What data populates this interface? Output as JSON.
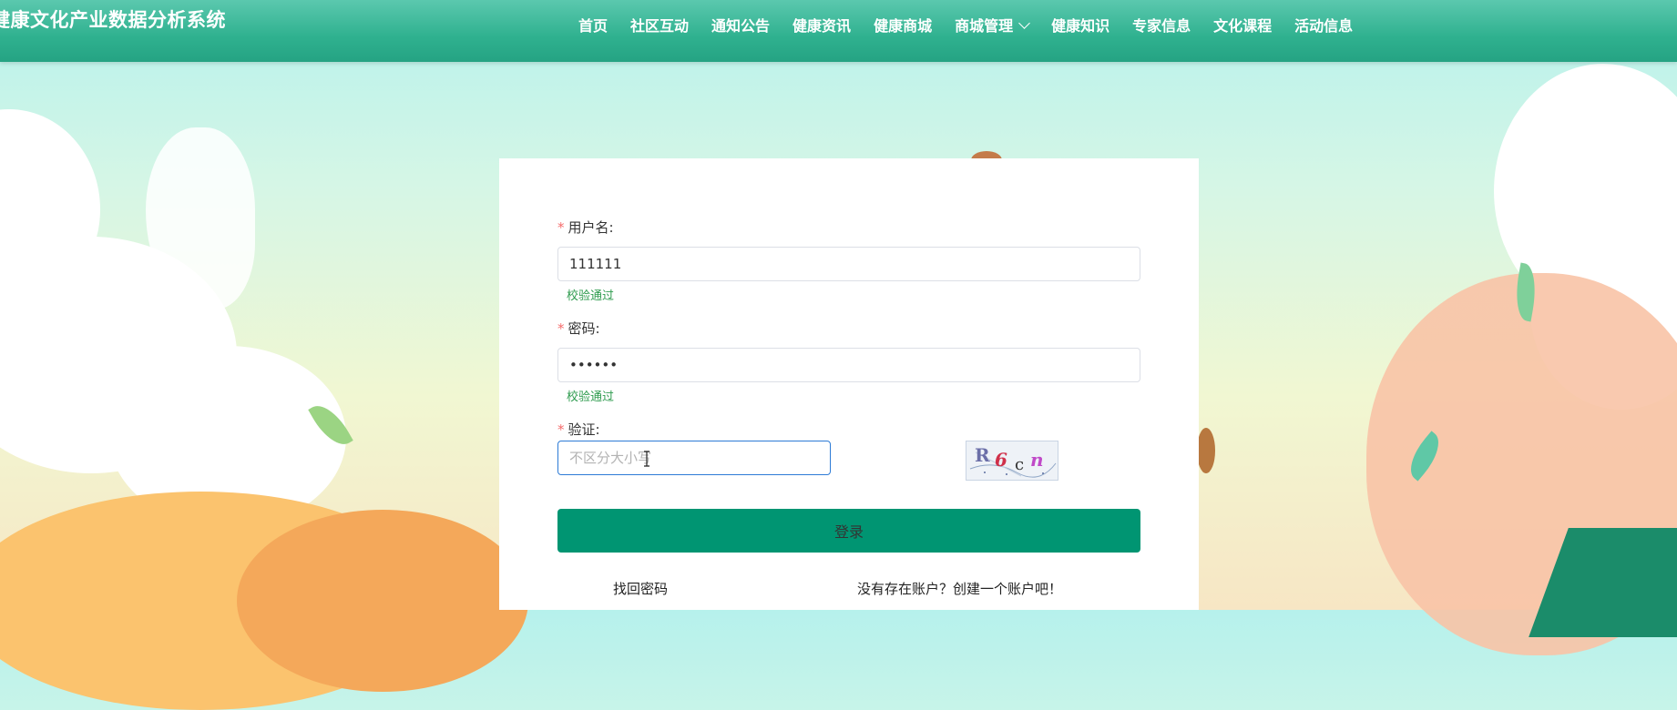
{
  "header": {
    "site_title": "健康文化产业数据分析系统",
    "nav": [
      {
        "label": "首页"
      },
      {
        "label": "社区互动"
      },
      {
        "label": "通知公告"
      },
      {
        "label": "健康资讯"
      },
      {
        "label": "健康商城"
      },
      {
        "label": "商城管理",
        "has_dropdown": true
      },
      {
        "label": "健康知识"
      },
      {
        "label": "专家信息"
      },
      {
        "label": "文化课程"
      },
      {
        "label": "活动信息"
      }
    ]
  },
  "login_form": {
    "required_mark": "*",
    "username": {
      "label": "用户名:",
      "value": "111111",
      "validation": "校验通过"
    },
    "password": {
      "label": "密码:",
      "value": "••••••",
      "validation": "校验通过"
    },
    "captcha": {
      "label": "验证:",
      "placeholder": "不区分大小写",
      "value": "",
      "image_text": "R6cn"
    },
    "submit_label": "登录",
    "forgot_link": "找回密码",
    "register_link": "没有存在账户？创建一个账户吧！"
  },
  "colors": {
    "header": "#2fb18f",
    "primary_button": "#009572",
    "success_text": "#2e9b4e",
    "required": "#f56c6c"
  }
}
